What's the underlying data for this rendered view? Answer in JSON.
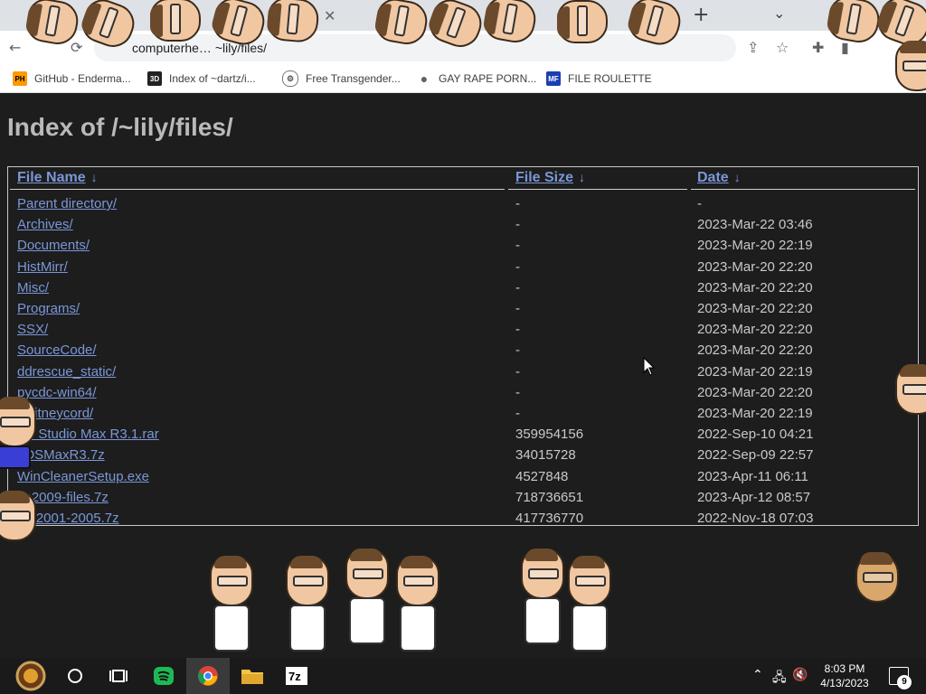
{
  "browser": {
    "url": "computerhell.net/~lily/files/",
    "url_visible": "computerhe… ~lily/files/",
    "bookmarks": [
      {
        "icon": "PH",
        "label": "GitHub - Enderma..."
      },
      {
        "icon": "3D",
        "label": "Index of ~dartz/i..."
      },
      {
        "icon": "⚙",
        "label": "Free Transgender..."
      },
      {
        "icon": "●",
        "label": "GAY RAPE PORN..."
      },
      {
        "icon": "MF",
        "label": "FILE ROULETTE"
      }
    ]
  },
  "page": {
    "title": "Index of /~lily/files/",
    "headers": {
      "name": "File Name",
      "size": "File Size",
      "date": "Date",
      "sort_arrow": "↓"
    },
    "rows": [
      {
        "name": "Parent directory/",
        "size": "-",
        "date": "-"
      },
      {
        "name": "Archives/",
        "size": "-",
        "date": "2023-Mar-22 03:46"
      },
      {
        "name": "Documents/",
        "size": "-",
        "date": "2023-Mar-20 22:19"
      },
      {
        "name": "HistMirr/",
        "size": "-",
        "date": "2023-Mar-20 22:20"
      },
      {
        "name": "Misc/",
        "size": "-",
        "date": "2023-Mar-20 22:20"
      },
      {
        "name": "Programs/",
        "size": "-",
        "date": "2023-Mar-20 22:20"
      },
      {
        "name": "SSX/",
        "size": "-",
        "date": "2023-Mar-20 22:20"
      },
      {
        "name": "SourceCode/",
        "size": "-",
        "date": "2023-Mar-20 22:20"
      },
      {
        "name": "ddrescue_static/",
        "size": "-",
        "date": "2023-Mar-20 22:19"
      },
      {
        "name": "pycdc-win64/",
        "size": "-",
        "date": "2023-Mar-20 22:20"
      },
      {
        "name": "whitneycord/",
        "size": "-",
        "date": "2023-Mar-20 22:19"
      },
      {
        "name": "3D Studio Max R3.1.rar",
        "size": "359954156",
        "date": "2022-Sep-10 04:21"
      },
      {
        "name": "3DSMaxR3.7z",
        "size": "34015728",
        "date": "2022-Sep-09 22:57"
      },
      {
        "name": "WinCleanerSetup.exe",
        "size": "4527848",
        "date": "2023-Apr-11 06:11"
      },
      {
        "name": "xp2009-files.7z",
        "size": "718736651",
        "date": "2023-Apr-12 08:57"
      },
      {
        "name": "xp-2001-2005.7z",
        "size": "417736770",
        "date": "2022-Nov-18 07:03"
      }
    ]
  },
  "taskbar": {
    "time": "8:03 PM",
    "date": "4/13/2023",
    "notification_count": "9",
    "apps": [
      "start",
      "search",
      "task-view",
      "spotify",
      "chrome",
      "file-explorer",
      "7zip"
    ]
  }
}
